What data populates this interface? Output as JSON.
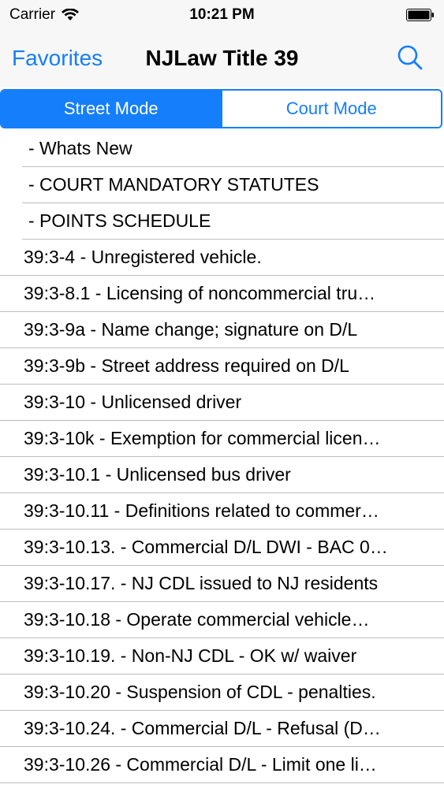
{
  "status": {
    "carrier": "Carrier",
    "time": "10:21 PM"
  },
  "nav": {
    "back_label": "Favorites",
    "title": "NJLaw Title 39"
  },
  "segments": {
    "street": "Street Mode",
    "court": "Court Mode"
  },
  "list": [
    {
      "label": "- Whats New"
    },
    {
      "label": "- COURT MANDATORY STATUTES"
    },
    {
      "label": "- POINTS SCHEDULE"
    },
    {
      "label": "39:3-4 - Unregistered vehicle."
    },
    {
      "label": "39:3-8.1 - Licensing of noncommercial tru…"
    },
    {
      "label": "39:3-9a - Name change; signature on D/L"
    },
    {
      "label": "39:3-9b - Street address required on D/L"
    },
    {
      "label": "39:3-10 - Unlicensed driver"
    },
    {
      "label": "39:3-10k - Exemption for commercial licen…"
    },
    {
      "label": "39:3-10.1 - Unlicensed bus driver"
    },
    {
      "label": "39:3-10.11 - Definitions related to commer…"
    },
    {
      "label": "39:3-10.13. - Commercial D/L DWI - BAC 0…"
    },
    {
      "label": "39:3-10.17. - NJ CDL issued to NJ residents"
    },
    {
      "label": "39:3-10.18 - Operate commercial vehicle…"
    },
    {
      "label": "39:3-10.19. - Non-NJ CDL - OK w/ waiver"
    },
    {
      "label": "39:3-10.20 - Suspension of CDL - penalties."
    },
    {
      "label": "39:3-10.24. - Commercial D/L - Refusal (D…"
    },
    {
      "label": "39:3-10.26 - Commercial D/L - Limit one li…"
    }
  ],
  "icons": {
    "search": "search-icon",
    "wifi": "wifi-icon",
    "battery": "battery-icon"
  },
  "colors": {
    "accent": "#157efb",
    "separator": "#bcbbc1",
    "bar_bg": "#f7f7f7"
  }
}
